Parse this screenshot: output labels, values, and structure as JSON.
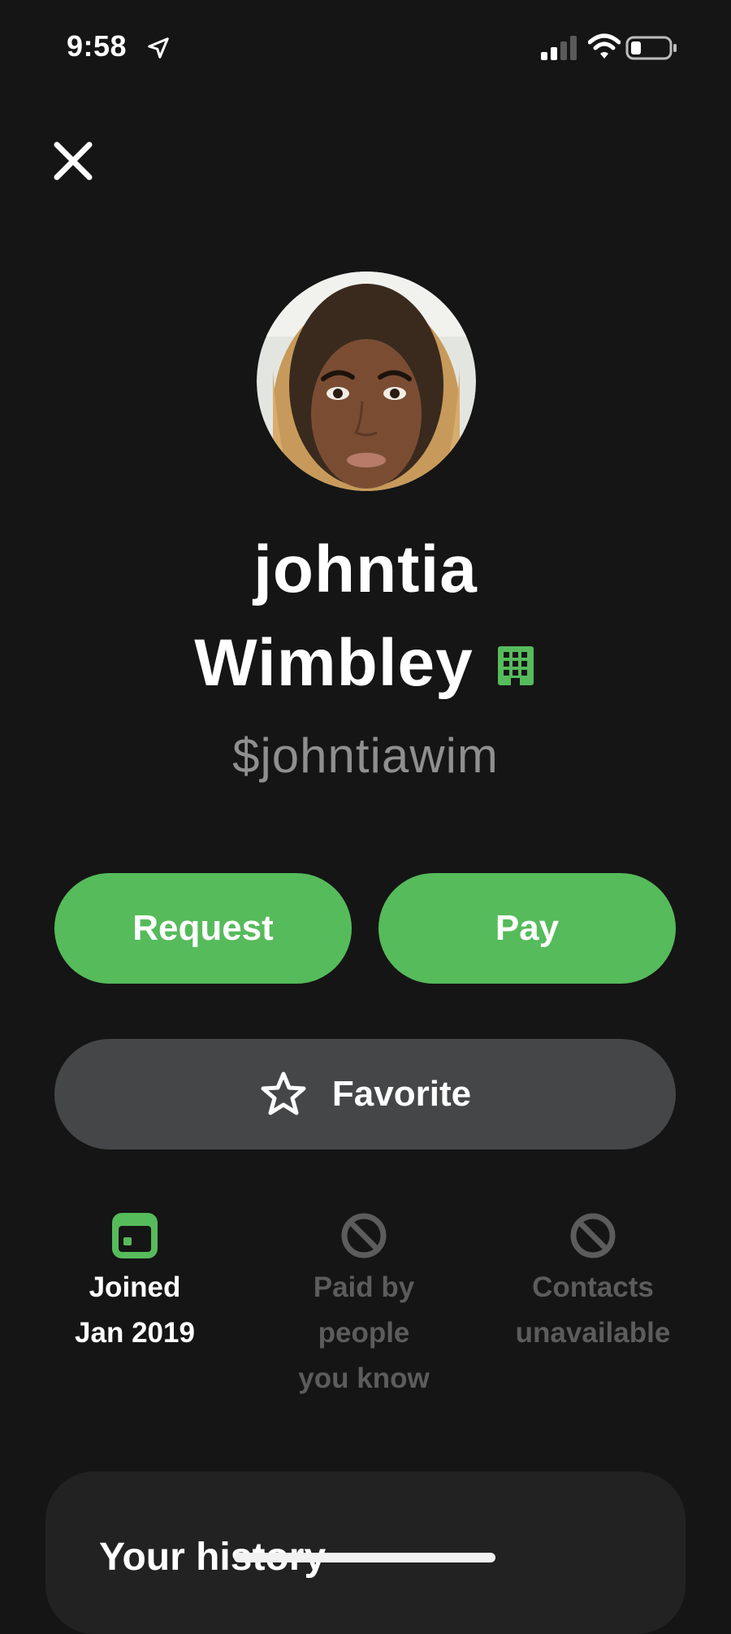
{
  "status_bar": {
    "time": "9:58",
    "icons": [
      "location-arrow-icon",
      "signal-icon",
      "wifi-icon",
      "battery-icon"
    ]
  },
  "header": {
    "close_icon": "close-icon"
  },
  "profile": {
    "first_name": "johntia",
    "last_name": "Wimbley",
    "business_icon": "building-icon",
    "cashtag": "$johntiawim"
  },
  "actions": {
    "request_label": "Request",
    "pay_label": "Pay",
    "favorite_label": "Favorite",
    "favorite_icon": "star-icon"
  },
  "stats": [
    {
      "icon": "calendar-icon",
      "line1": "Joined",
      "line2": "Jan 2019",
      "line3": "",
      "active": true
    },
    {
      "icon": "prohibited-icon",
      "line1": "Paid by",
      "line2": "people",
      "line3": "you know",
      "active": false
    },
    {
      "icon": "prohibited-icon",
      "line1": "Contacts",
      "line2": "unavailable",
      "line3": "",
      "active": false
    }
  ],
  "history": {
    "title": "Your history"
  },
  "colors": {
    "background": "#151515",
    "accent_green": "#56bb5b",
    "secondary_button": "#454647",
    "muted_text": "#8f8f8f",
    "disabled_text": "#5c5c5c"
  }
}
